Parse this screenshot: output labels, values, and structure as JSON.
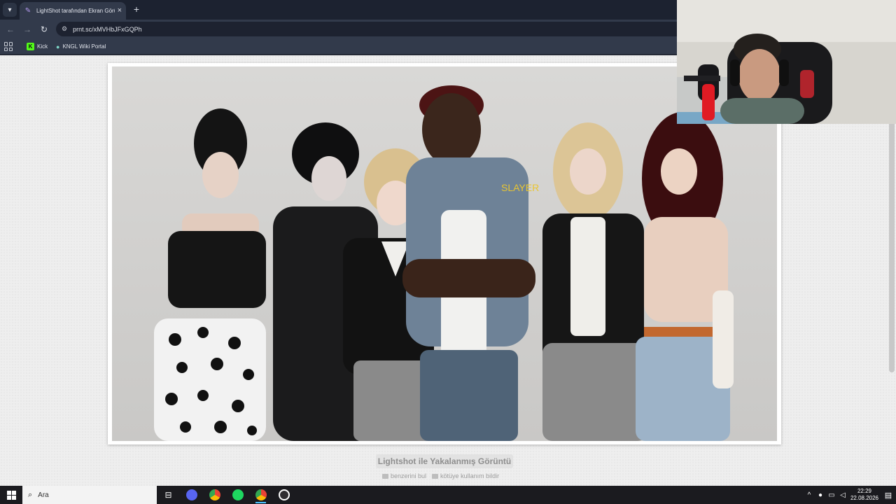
{
  "browser": {
    "tab": {
      "title": "LightShot tarafından Ekran Görüntüsü",
      "favicon": "lightshot-feather-icon"
    },
    "new_tab_label": "+",
    "url": "prnt.sc/xMVHbJFxGQPh",
    "bookmarks": [
      {
        "label": "Kick",
        "icon": "kick-icon"
      },
      {
        "label": "KNGL Wiki Portal",
        "icon": "wiki-globe-icon"
      }
    ]
  },
  "page": {
    "caption": "Lightshot ile Yakalanmış Görüntü",
    "links": [
      {
        "label": "benzerini bul",
        "icon": "image-icon"
      },
      {
        "label": "kötüye kullanım bildir",
        "icon": "flag-icon"
      }
    ]
  },
  "taskbar": {
    "search_placeholder": "Ara",
    "apps": [
      "task-view-icon",
      "discord-icon",
      "chrome-icon",
      "spotify-icon",
      "chrome-icon",
      "obs-icon"
    ],
    "time": "22:29",
    "date": "22.08.2026"
  },
  "colors": {
    "chrome_dark": "#1c2230",
    "chrome_mid": "#323a4b",
    "page_bg": "#eeeeee",
    "taskbar": "#1b1b1f",
    "accent": "#4cc2ff"
  }
}
